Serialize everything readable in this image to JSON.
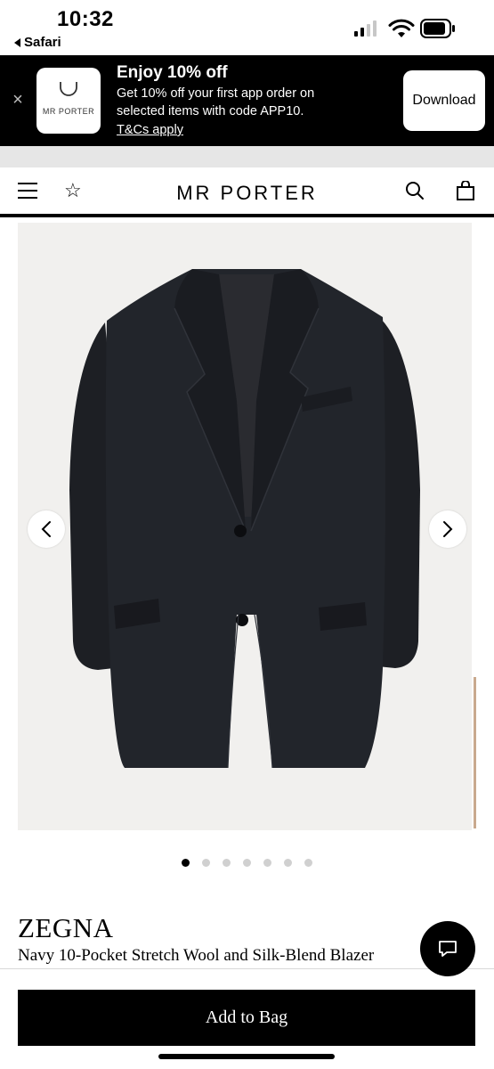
{
  "status_bar": {
    "time": "10:32",
    "back_app": "Safari",
    "icons": [
      "signal-icon",
      "wifi-icon",
      "battery-icon"
    ]
  },
  "promo": {
    "logo_text": "MR PORTER",
    "title": "Enjoy 10% off",
    "line1": "Get 10% off your first app order on",
    "line2": "selected items with code APP10.",
    "terms": "T&Cs apply",
    "download_label": "Download",
    "close_icon": "close-icon"
  },
  "header": {
    "brand": "MR PORTER",
    "icons": [
      "menu-icon",
      "star-icon",
      "search-icon",
      "bag-icon"
    ]
  },
  "gallery": {
    "image_subject": "navy blazer",
    "dot_count": 7,
    "active_index": 0,
    "prev_icon": "chevron-left-icon",
    "next_icon": "chevron-right-icon"
  },
  "product": {
    "designer": "ZEGNA",
    "name": "Navy 10-Pocket Stretch Wool and Silk-Blend Blazer"
  },
  "actions": {
    "add_to_bag": "Add to Bag",
    "chat_icon": "chat-icon"
  },
  "colors": {
    "banner_bg": "#000000",
    "image_bg": "#f1f0ee",
    "blazer": "#1d1f24",
    "dot_inactive": "#d0d0d0"
  }
}
